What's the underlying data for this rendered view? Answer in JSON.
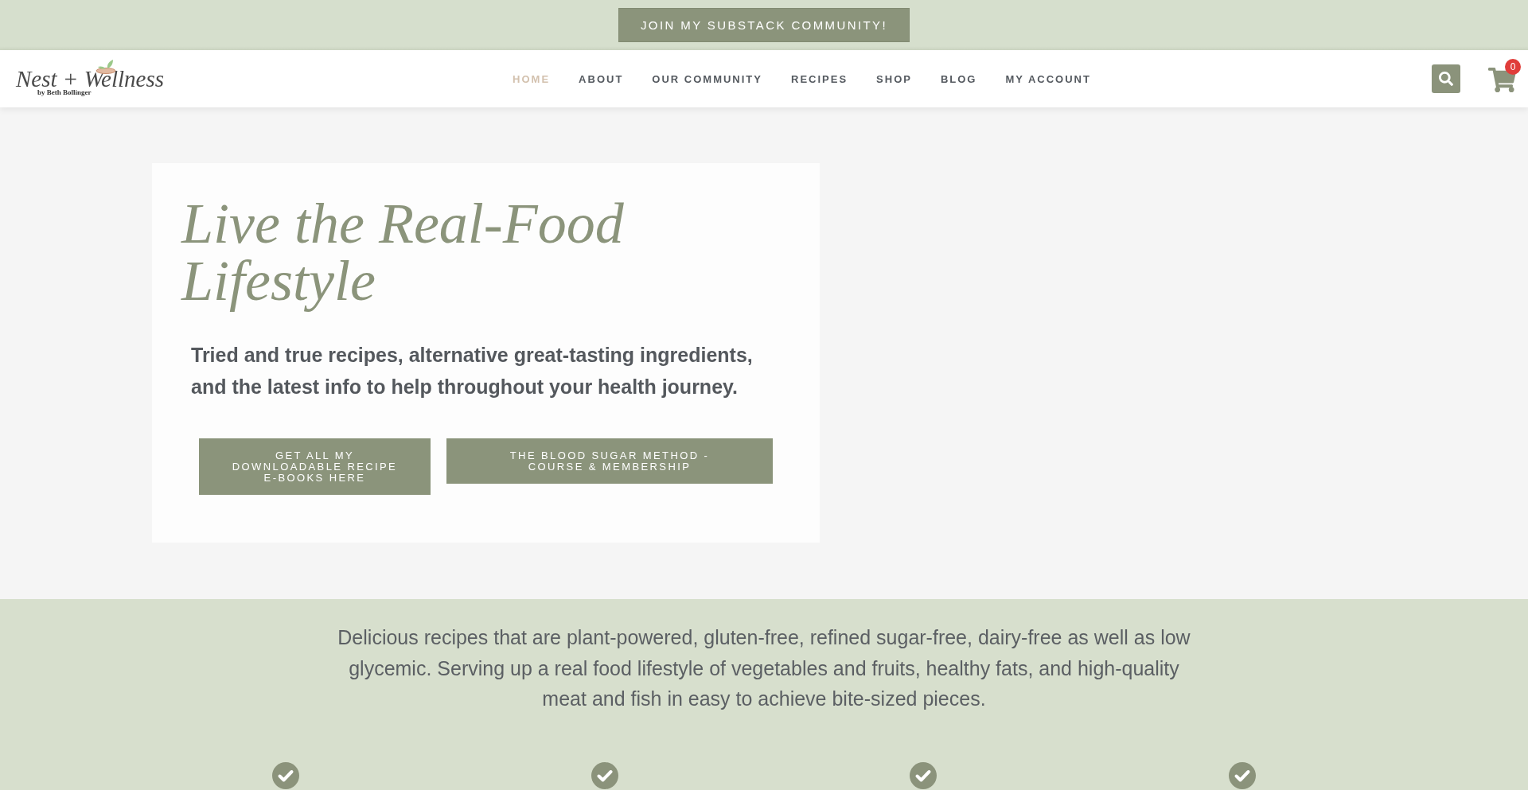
{
  "announcement_bar": {
    "button": "JOIN MY SUBSTACK COMMUNITY!"
  },
  "header": {
    "logo": {
      "name": "Nest + Wellness",
      "byline": "by Beth Bollinger"
    },
    "nav": [
      {
        "label": "HOME",
        "selected": true
      },
      {
        "label": "ABOUT",
        "selected": false
      },
      {
        "label": "OUR COMMUNITY",
        "selected": false
      },
      {
        "label": "RECIPES",
        "selected": false
      },
      {
        "label": "SHOP",
        "selected": false
      },
      {
        "label": "BLOG",
        "selected": false
      },
      {
        "label": "MY ACCOUNT",
        "selected": false
      }
    ],
    "cart": {
      "count": "0"
    }
  },
  "hero": {
    "heading": "Live the Real-Food Lifestyle",
    "subtitle": "Tried and true recipes, alternative great-tasting ingredients, and the latest info to help throughout your health journey.",
    "buttons": [
      "GET ALL MY DOWNLOADABLE RECIPE E-BOOKS HERE",
      "THE BLOOD SUGAR METHOD - COURSE & MEMBERSHIP"
    ]
  },
  "intro": {
    "text": "Delicious recipes that are plant-powered, gluten-free, refined sugar-free, dairy-free as well as low glycemic. Serving up a real food lifestyle of vegetables and fruits, healthy fats, and high-quality meat and fish in easy to achieve bite-sized pieces.",
    "features": [
      {
        "kind": "check"
      },
      {
        "kind": "check"
      },
      {
        "kind": "check"
      },
      {
        "kind": "check"
      }
    ]
  }
}
